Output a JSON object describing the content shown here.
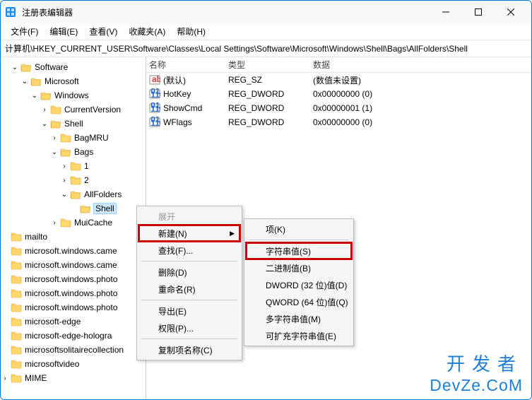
{
  "window": {
    "title": "注册表编辑器"
  },
  "menu": {
    "file": "文件(F)",
    "edit": "编辑(E)",
    "view": "查看(V)",
    "fav": "收藏夹(A)",
    "help": "帮助(H)"
  },
  "address": "计算机\\HKEY_CURRENT_USER\\Software\\Classes\\Local Settings\\Software\\Microsoft\\Windows\\Shell\\Bags\\AllFolders\\Shell",
  "tree": {
    "n0": "Software",
    "n1": "Microsoft",
    "n2": "Windows",
    "n3": "CurrentVersion",
    "n4": "Shell",
    "n5": "BagMRU",
    "n6": "Bags",
    "n7": "1",
    "n8": "2",
    "n9": "AllFolders",
    "n10": "Shell",
    "n11": "MuiCache",
    "n12": "mailto",
    "n13": "microsoft.windows.came",
    "n14": "microsoft.windows.came",
    "n15": "microsoft.windows.photo",
    "n16": "microsoft.windows.photo",
    "n17": "microsoft.windows.photo",
    "n18": "microsoft-edge",
    "n19": "microsoft-edge-hologra",
    "n20": "microsoftsolitairecollection",
    "n21": "microsoftvideo",
    "n22": "MIME"
  },
  "cols": {
    "name": "名称",
    "type": "类型",
    "data": "数据"
  },
  "rows": [
    {
      "icon": "str",
      "name": "(默认)",
      "type": "REG_SZ",
      "data": "(数值未设置)"
    },
    {
      "icon": "bin",
      "name": "HotKey",
      "type": "REG_DWORD",
      "data": "0x00000000 (0)"
    },
    {
      "icon": "bin",
      "name": "ShowCmd",
      "type": "REG_DWORD",
      "data": "0x00000001 (1)"
    },
    {
      "icon": "bin",
      "name": "WFlags",
      "type": "REG_DWORD",
      "data": "0x00000000 (0)"
    }
  ],
  "ctx": {
    "expand": "展开",
    "new": "新建(N)",
    "find": "查找(F)...",
    "delete": "删除(D)",
    "rename": "重命名(R)",
    "export": "导出(E)",
    "perm": "权限(P)...",
    "copyname": "复制项名称(C)"
  },
  "sub": {
    "key": "项(K)",
    "string": "字符串值(S)",
    "binary": "二进制值(B)",
    "dword": "DWORD (32 位)值(D)",
    "qword": "QWORD (64 位)值(Q)",
    "multi": "多字符串值(M)",
    "expand": "可扩充字符串值(E)"
  },
  "watermark": {
    "l1": "开发者",
    "l2": "DevZe.CoM"
  }
}
